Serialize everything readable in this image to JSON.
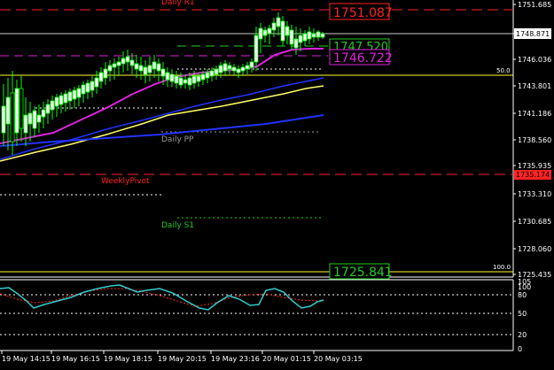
{
  "chart_data": {
    "type": "candlestick",
    "instrument": "",
    "main_panel": {
      "y_axis_ticks": [
        "1751.685",
        "1748.871",
        "1746.036",
        "1743.801",
        "1741.186",
        "1738.560",
        "1735.935",
        "1733.310",
        "1730.685",
        "1728.060",
        "1725.435"
      ],
      "price_boxes": [
        {
          "label": "1751.087",
          "color": "#ff2222"
        },
        {
          "label": "1747.520",
          "color": "#22cc22"
        },
        {
          "label": "1746.722",
          "color": "#dd22dd"
        },
        {
          "label": "1735.174",
          "color": "#ff2222"
        },
        {
          "label": "1725.841",
          "color": "#22cc22"
        }
      ],
      "current_price": "1748.871",
      "level_labels": [
        {
          "text": "Daily R1",
          "color": "#ff2222"
        },
        {
          "text": "Daily PP",
          "color": "#999999"
        },
        {
          "text": "WeeklyPivot",
          "color": "#ff2222"
        },
        {
          "text": "Daily S1",
          "color": "#22cc22"
        }
      ],
      "fib_labels": [
        "50.0",
        "100.0"
      ],
      "series": [
        {
          "name": "",
          "color": "#dd22dd"
        },
        {
          "name": "",
          "color": "#ffff66"
        },
        {
          "name": "",
          "color": "#2233ff"
        }
      ]
    },
    "oscillator_panel": {
      "y_axis_ticks": [
        "105",
        "100",
        "80",
        "50",
        "20",
        "0"
      ],
      "series": [
        {
          "name": "",
          "color": "#33cccc"
        },
        {
          "name": "",
          "color": "#ff2222"
        }
      ]
    },
    "x_axis_ticks": [
      "19 May 14:15",
      "19 May 16:15",
      "19 May 18:15",
      "19 May 20:15",
      "19 May 23:16",
      "20 May 01:15",
      "20 May 03:15"
    ]
  },
  "colors": {
    "background": "#000000",
    "axis": "#ffffff",
    "bull_candle": "#ffffff",
    "bear_candle": "#000000",
    "candle_outline": "#00ff00"
  }
}
